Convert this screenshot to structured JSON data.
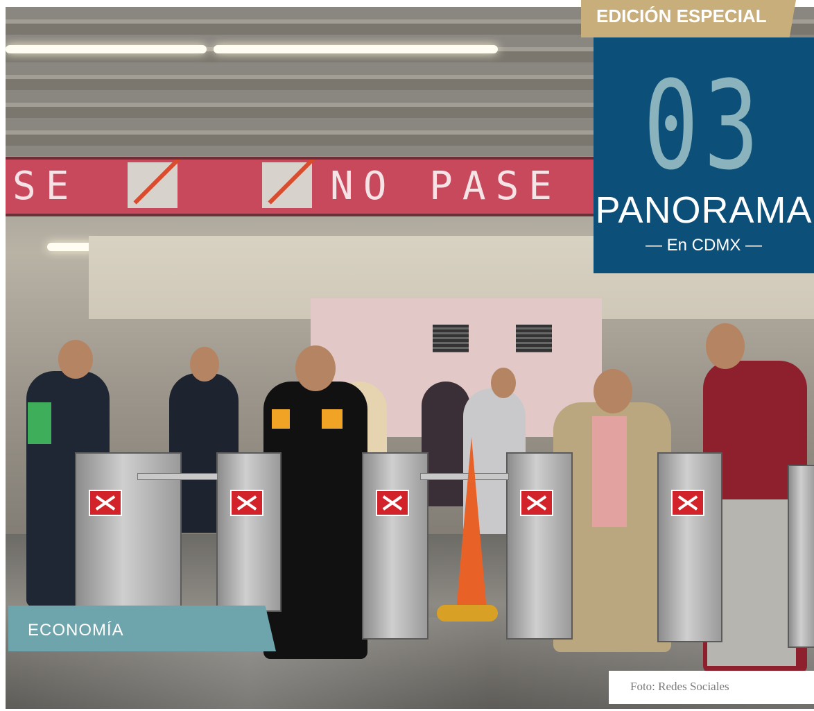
{
  "edition_badge": {
    "label": "EDICIÓN ESPECIAL"
  },
  "section_badge": {
    "number": "03",
    "title": "PANORAMA",
    "subtitle": "— En CDMX —"
  },
  "category_tag": {
    "label": "ECONOMÍA"
  },
  "photo_credit": {
    "text": "Foto: Redes Sociales"
  },
  "photo": {
    "sign_left": "SE",
    "sign_right": "NO PASE",
    "turnstile_label": "NO PASE"
  },
  "colors": {
    "gold": "#c7ae7a",
    "navy": "#0c4f78",
    "number_teal": "#8ab3bd",
    "tag_teal": "#6ea5ad",
    "sign_pink": "#c8485c"
  }
}
